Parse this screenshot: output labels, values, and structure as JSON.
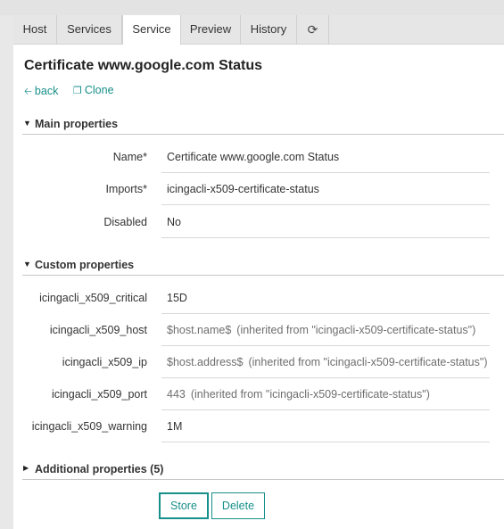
{
  "tabs": [
    {
      "label": "Host"
    },
    {
      "label": "Services"
    },
    {
      "label": "Service"
    },
    {
      "label": "Preview"
    },
    {
      "label": "History"
    }
  ],
  "refresh_icon": "refresh-icon",
  "active_tab": "Service",
  "page": {
    "title": "Certificate www.google.com Status",
    "back_label": "back",
    "clone_label": "Clone"
  },
  "sections": {
    "main": "Main properties",
    "custom": "Custom properties",
    "additional": "Additional properties (5)"
  },
  "main_properties": [
    {
      "label": "Name*",
      "value": "Certificate www.google.com Status"
    },
    {
      "label": "Imports*",
      "value": "icingacli-x509-certificate-status"
    },
    {
      "label": "Disabled",
      "value": "No"
    }
  ],
  "custom_properties": [
    {
      "label": "icingacli_x509_critical",
      "value": "15D",
      "inherited": ""
    },
    {
      "label": "icingacli_x509_host",
      "value": "$host.name$",
      "inherited": "(inherited from \"icingacli-x509-certificate-status\")"
    },
    {
      "label": "icingacli_x509_ip",
      "value": "$host.address$",
      "inherited": "(inherited from \"icingacli-x509-certificate-status\")"
    },
    {
      "label": "icingacli_x509_port",
      "value": "443",
      "inherited": "(inherited from \"icingacli-x509-certificate-status\")"
    },
    {
      "label": "icingacli_x509_warning",
      "value": "1M",
      "inherited": ""
    }
  ],
  "buttons": {
    "store": "Store",
    "delete": "Delete"
  },
  "colors": {
    "accent": "#178f8a",
    "tab_bar": "#e6e6e6"
  }
}
